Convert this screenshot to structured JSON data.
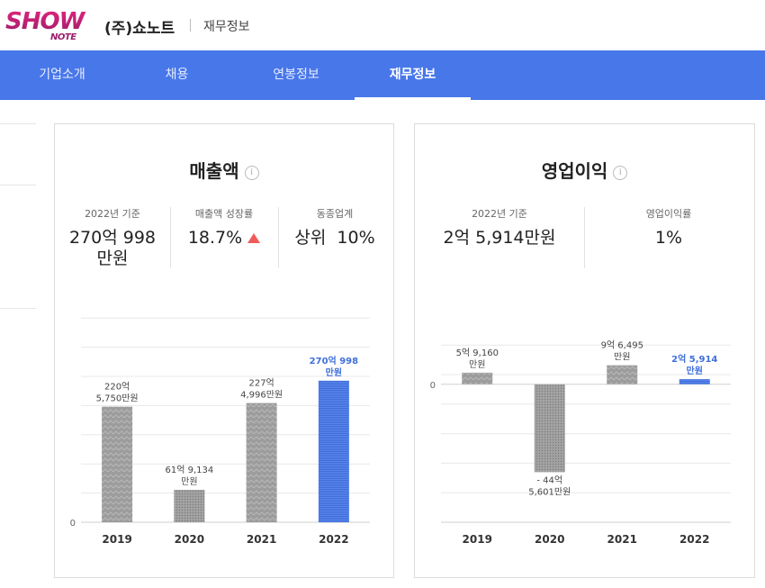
{
  "header": {
    "logo_top": "SHOW",
    "logo_bottom": "NOTE",
    "company": "(주)쇼노트",
    "breadcrumb": "재무정보"
  },
  "nav": {
    "tabs": [
      "기업소개",
      "채용",
      "연봉정보",
      "재무정보"
    ],
    "active_index": 3
  },
  "revenue": {
    "title": "매출액",
    "info_icon": "info-icon",
    "stats": [
      {
        "label": "2022년 기준",
        "value": "270억 998\n만원"
      },
      {
        "label": "매출액 성장률",
        "value": "18.7%",
        "trend": "up",
        "trend_color": "#ef5b5b"
      },
      {
        "label": "동종업계",
        "value": "상위  10%"
      }
    ]
  },
  "profit": {
    "title": "영업이익",
    "info_icon": "info-icon",
    "stats": [
      {
        "label": "2022년 기준",
        "value": "2억 5,914만원"
      },
      {
        "label": "영업이익률",
        "value": "1%"
      }
    ]
  },
  "chart_data": [
    {
      "type": "bar",
      "title": "매출액",
      "unit": "억원",
      "categories": [
        "2019",
        "2020",
        "2021",
        "2022"
      ],
      "values": [
        220.575,
        61.9134,
        227.4996,
        270.0998
      ],
      "labels": [
        "220억\n5,750만원",
        "61억 9,134\n만원",
        "227억\n4,996만원",
        "270억 998\n만원"
      ],
      "y_axis_label": "0",
      "highlight_index": 3,
      "colors": {
        "default": "#9e9e9e",
        "highlight": "#3f6fdc",
        "highlight_text": "#3f6fdc"
      }
    },
    {
      "type": "bar",
      "title": "영업이익",
      "unit": "억원",
      "categories": [
        "2019",
        "2020",
        "2021",
        "2022"
      ],
      "values": [
        5.916,
        -44.5601,
        9.6495,
        2.5914
      ],
      "labels": [
        "5억 9,160\n만원",
        "- 44억\n5,601만원",
        "9억 6,495\n만원",
        "2억 5,914\n만원"
      ],
      "y_axis_label": "0",
      "highlight_index": 3,
      "colors": {
        "default": "#9e9e9e",
        "highlight": "#3f6fdc",
        "highlight_text": "#3f6fdc"
      }
    }
  ]
}
